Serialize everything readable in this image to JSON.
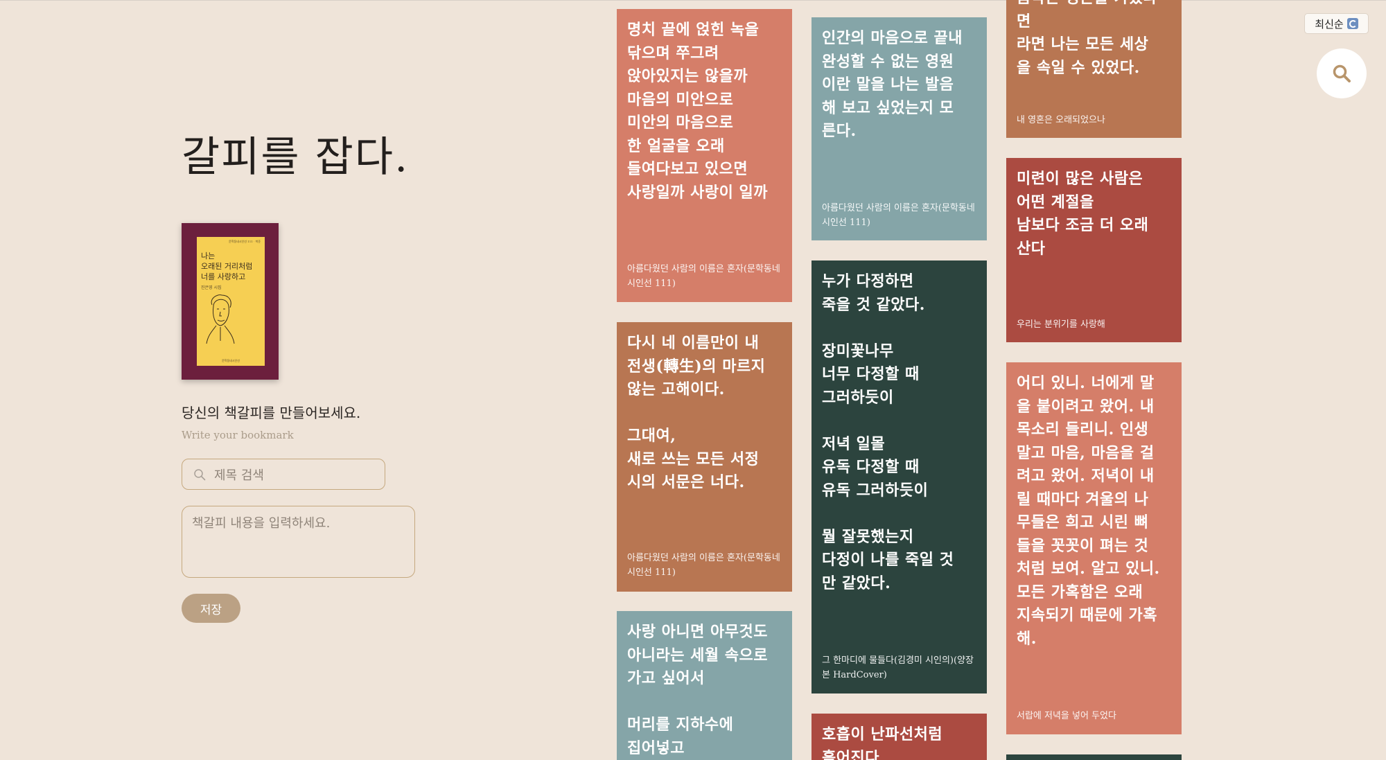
{
  "page": {
    "title": "갈피를 잡다.",
    "make_heading": "당신의 책갈피를 만들어보세요.",
    "sub_heading": "Write your bookmark"
  },
  "book": {
    "publisher_top": "문학동네시인선 111 · 박준",
    "title_lines": [
      "나는",
      "오래된 거리처럼",
      "너를 사랑하고"
    ],
    "author": "진은영 시집",
    "publisher_bottom": "문학동네시인선"
  },
  "form": {
    "search_placeholder": "제목 검색",
    "content_placeholder": "책갈피 내용을 입력하세요.",
    "save_label": "저장"
  },
  "controls": {
    "sort_label": "최신순"
  },
  "colors": {
    "background": "#efe4d9",
    "salmon": "#d57e69",
    "copper": "#b87652",
    "teal": "#85a5a8",
    "dark_green": "#2c443e",
    "brick": "#ab4b41",
    "button": "#bba184"
  },
  "cards": [
    {
      "text": "명치 끝에 얹힌 녹을\n닦으며 쭈그려\n앉아있지는 않을까\n마음의 미안으로\n미안의 마음으로\n한 얼굴을 오래\n들여다보고 있으면\n사랑일까 사랑이 일까",
      "source": "아름다웠던 사람의 이름은 혼자(문학동네시인선 111)"
    },
    {
      "text": "다시 네 이름만이 내\n전생(轉生)의 마르지\n않는 고해이다.\n\n그대여,\n새로 쓰는 모든 서정\n시의 서문은 너다.",
      "source": "아름다웠던 사람의 이름은 혼자(문학동네시인선 111)"
    },
    {
      "text": "사랑 아니면 아무것도\n아니라는 세월 속으로\n가고 싶어서\n\n머리를 지하수에\n집어넣고",
      "source": ""
    },
    {
      "text": "인간의 마음으로 끝내\n완성할 수 없는 영원\n이란 말을 나는 발음\n해 보고 싶었는지 모\n른다.",
      "source": "아름다웠던 사람의 이름은 혼자(문학동네시인선 111)"
    },
    {
      "text": "누가 다정하면\n죽을 것 같았다.\n\n장미꽃나무\n너무 다정할 때\n그러하듯이\n\n저녁 일몰\n유독 다정할 때\n유독 그러하듯이\n\n뭘 잘못했는지\n다정이 나를 죽일 것\n만 같았다.",
      "source": "그 한마디에 물들다(김경미 시인의)(양장본 HardCover)"
    },
    {
      "text": "호흡이 난파선처럼\n흩어진다",
      "source": ""
    },
    {
      "text": "음악은 영혼을 가졌다면\n라면 나는 모든 세상\n을 속일 수 있었다.",
      "source": "내 영혼은 오래되었으나"
    },
    {
      "text": "미련이 많은 사람은\n어떤 계절을\n남보다 조금 더 오래\n산다",
      "source": "우리는 분위기를 사랑해"
    },
    {
      "text": "어디 있니. 너에게 말\n을 붙이려고 왔어. 내\n목소리 들리니. 인생\n말고 마음, 마음을 걸\n려고 왔어. 저녁이 내\n릴 때마다 겨울의 나\n무들은 희고 시린 뼈\n들을 꼿꼿이 펴는 것\n처럼 보여. 알고 있니.\n모든 가혹함은 오래\n지속되기 때문에 가혹\n해.",
      "source": "서랍에 저녁을 넣어 두었다"
    },
    {
      "text": "",
      "source": ""
    }
  ]
}
